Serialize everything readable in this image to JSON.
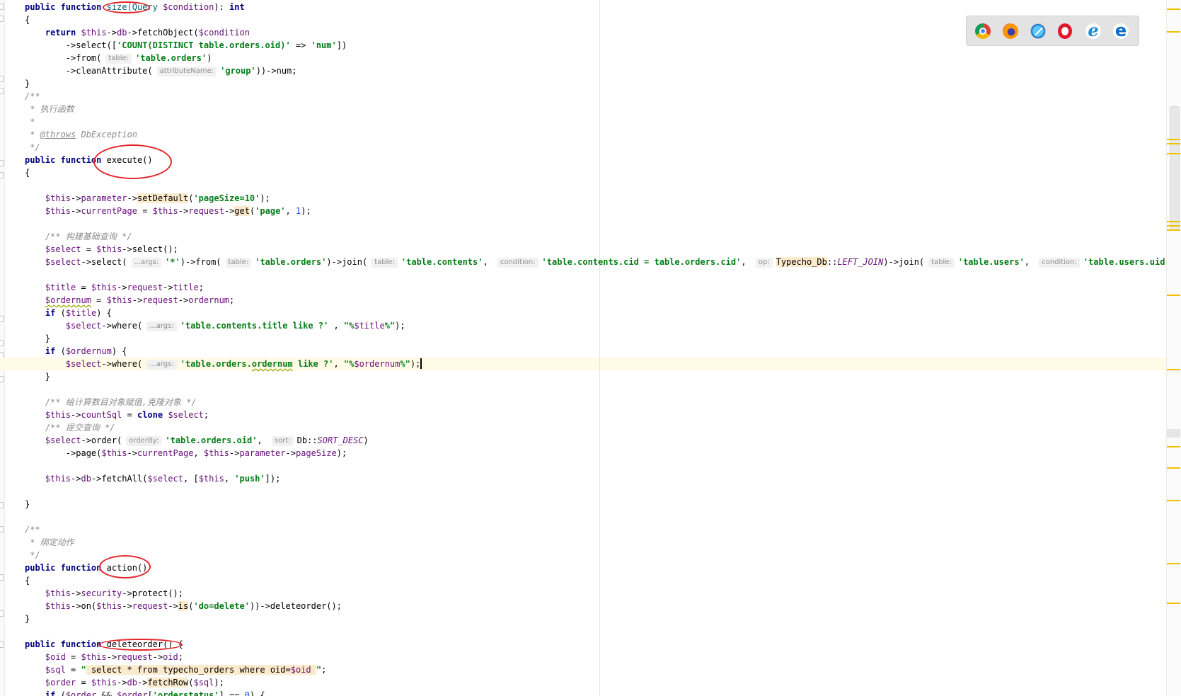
{
  "editor": {
    "lines": [
      {
        "parts": [
          {
            "t": "public function ",
            "c": "kw"
          },
          {
            "t": "size(Query ",
            "c": "fn"
          },
          {
            "t": "$condition",
            "c": "var"
          },
          {
            "t": "): "
          },
          {
            "t": "int",
            "c": "kw"
          }
        ]
      },
      {
        "parts": [
          {
            "t": "{"
          }
        ]
      },
      {
        "parts": [
          {
            "t": "    "
          },
          {
            "t": "return ",
            "c": "kw"
          },
          {
            "t": "$this",
            "c": "var"
          },
          {
            "t": "->"
          },
          {
            "t": "db",
            "c": "var"
          },
          {
            "t": "->fetchObject("
          },
          {
            "t": "$condition",
            "c": "var"
          }
        ]
      },
      {
        "parts": [
          {
            "t": "        ->select(["
          },
          {
            "t": "'COUNT(DISTINCT table.orders.oid)'",
            "c": "s"
          },
          {
            "t": " => "
          },
          {
            "t": "'num'",
            "c": "s"
          },
          {
            "t": "])"
          }
        ]
      },
      {
        "parts": [
          {
            "t": "        ->from("
          },
          {
            "h": "table:"
          },
          {
            "t": "'table.orders'",
            "c": "s"
          },
          {
            "t": ")"
          }
        ]
      },
      {
        "parts": [
          {
            "t": "        ->cleanAttribute("
          },
          {
            "h": "attributeName:"
          },
          {
            "t": "'group'",
            "c": "s"
          },
          {
            "t": "))->num;"
          }
        ]
      },
      {
        "parts": [
          {
            "t": "}"
          }
        ]
      },
      {
        "parts": [
          {
            "t": "/**",
            "c": "cm"
          }
        ]
      },
      {
        "parts": [
          {
            "t": " * 执行函数",
            "c": "cm"
          }
        ]
      },
      {
        "parts": [
          {
            "t": " *",
            "c": "cm"
          }
        ]
      },
      {
        "parts": [
          {
            "t": " * ",
            "c": "cm"
          },
          {
            "t": "@throws",
            "c": "tag"
          },
          {
            "t": " DbException",
            "c": "cm"
          }
        ]
      },
      {
        "parts": [
          {
            "t": " */",
            "c": "cm"
          }
        ]
      },
      {
        "parts": [
          {
            "t": "public function ",
            "c": "kw"
          },
          {
            "t": "execute()"
          }
        ]
      },
      {
        "parts": [
          {
            "t": "{"
          }
        ]
      },
      {
        "parts": []
      },
      {
        "parts": [
          {
            "t": "    "
          },
          {
            "t": "$this",
            "c": "var"
          },
          {
            "t": "->"
          },
          {
            "t": "parameter",
            "c": "var"
          },
          {
            "t": "->"
          },
          {
            "t": "setDefault",
            "c": "hl"
          },
          {
            "t": "("
          },
          {
            "t": "'pageSize=10'",
            "c": "s"
          },
          {
            "t": ");"
          }
        ]
      },
      {
        "parts": [
          {
            "t": "    "
          },
          {
            "t": "$this",
            "c": "var"
          },
          {
            "t": "->"
          },
          {
            "t": "currentPage",
            "c": "var"
          },
          {
            "t": " = "
          },
          {
            "t": "$this",
            "c": "var"
          },
          {
            "t": "->"
          },
          {
            "t": "request",
            "c": "var"
          },
          {
            "t": "->"
          },
          {
            "t": "get",
            "c": "hl"
          },
          {
            "t": "("
          },
          {
            "t": "'page'",
            "c": "s"
          },
          {
            "t": ", "
          },
          {
            "t": "1",
            "c": "num"
          },
          {
            "t": ");"
          }
        ]
      },
      {
        "parts": []
      },
      {
        "parts": [
          {
            "t": "    "
          },
          {
            "t": "/** 构建基础查询 */",
            "c": "cm"
          }
        ]
      },
      {
        "parts": [
          {
            "t": "    "
          },
          {
            "t": "$select",
            "c": "var"
          },
          {
            "t": " = "
          },
          {
            "t": "$this",
            "c": "var"
          },
          {
            "t": "->select();"
          }
        ]
      },
      {
        "parts": [
          {
            "t": "    "
          },
          {
            "t": "$select",
            "c": "var"
          },
          {
            "t": "->select("
          },
          {
            "h": "...args:"
          },
          {
            "t": "'*'",
            "c": "s"
          },
          {
            "t": ")->from("
          },
          {
            "h": "table:"
          },
          {
            "t": "'table.orders'",
            "c": "s"
          },
          {
            "t": ")->join("
          },
          {
            "h": "table:"
          },
          {
            "t": "'table.contents'",
            "c": "s"
          },
          {
            "t": ", "
          },
          {
            "h": "condition:"
          },
          {
            "t": "'table.contents.cid = table.orders.cid'",
            "c": "s"
          },
          {
            "t": ", "
          },
          {
            "h": "op:"
          },
          {
            "t": "Typecho_Db",
            "c": "hl"
          },
          {
            "t": "::"
          },
          {
            "t": "LEFT_JOIN",
            "c": "const"
          },
          {
            "t": ")->join("
          },
          {
            "h": "table:"
          },
          {
            "t": "'table.users'",
            "c": "s"
          },
          {
            "t": ", "
          },
          {
            "h": "condition:"
          },
          {
            "t": "'table.users.uid = table.",
            "c": "s"
          }
        ]
      },
      {
        "parts": []
      },
      {
        "parts": [
          {
            "t": "    "
          },
          {
            "t": "$title",
            "c": "var"
          },
          {
            "t": " = "
          },
          {
            "t": "$this",
            "c": "var"
          },
          {
            "t": "->"
          },
          {
            "t": "request",
            "c": "var"
          },
          {
            "t": "->"
          },
          {
            "t": "title",
            "c": "var"
          },
          {
            "t": ";"
          }
        ]
      },
      {
        "parts": [
          {
            "t": "    "
          },
          {
            "t": "$ordernum",
            "c": "var warn"
          },
          {
            "t": " = "
          },
          {
            "t": "$this",
            "c": "var"
          },
          {
            "t": "->"
          },
          {
            "t": "request",
            "c": "var"
          },
          {
            "t": "->"
          },
          {
            "t": "ordernum",
            "c": "var"
          },
          {
            "t": ";"
          }
        ]
      },
      {
        "parts": [
          {
            "t": "    "
          },
          {
            "t": "if ",
            "c": "kw"
          },
          {
            "t": "("
          },
          {
            "t": "$title",
            "c": "var"
          },
          {
            "t": ") {"
          }
        ]
      },
      {
        "parts": [
          {
            "t": "        "
          },
          {
            "t": "$select",
            "c": "var"
          },
          {
            "t": "->where("
          },
          {
            "h": "...args:"
          },
          {
            "t": "'table.contents.title like ?'",
            "c": "s"
          },
          {
            "t": " , "
          },
          {
            "t": "\"%",
            "c": "s"
          },
          {
            "t": "$title",
            "c": "var"
          },
          {
            "t": "%\"",
            "c": "s"
          },
          {
            "t": ");"
          }
        ]
      },
      {
        "parts": [
          {
            "t": "    }"
          }
        ]
      },
      {
        "parts": [
          {
            "t": "    "
          },
          {
            "t": "if ",
            "c": "kw"
          },
          {
            "t": "("
          },
          {
            "t": "$ordernum",
            "c": "var"
          },
          {
            "t": ") {"
          }
        ]
      },
      {
        "parts": [
          {
            "t": "        "
          },
          {
            "t": "$select",
            "c": "var"
          },
          {
            "t": "->where("
          },
          {
            "h": "...args:"
          },
          {
            "t": "'table.orders.",
            "c": "s"
          },
          {
            "t": "ordernum",
            "c": "s warn"
          },
          {
            "t": " like ?'",
            "c": "s"
          },
          {
            "t": ", "
          },
          {
            "t": "\"%",
            "c": "s"
          },
          {
            "t": "$ordernum",
            "c": "var"
          },
          {
            "t": "%\"",
            "c": "s"
          },
          {
            "t": ");"
          },
          {
            "caret": true
          }
        ]
      },
      {
        "parts": [
          {
            "t": "    }"
          }
        ]
      },
      {
        "parts": []
      },
      {
        "parts": [
          {
            "t": "    "
          },
          {
            "t": "/** 给计算数目对象赋值,克隆对象 */",
            "c": "cm"
          }
        ]
      },
      {
        "parts": [
          {
            "t": "    "
          },
          {
            "t": "$this",
            "c": "var"
          },
          {
            "t": "->"
          },
          {
            "t": "countSql",
            "c": "var"
          },
          {
            "t": " = "
          },
          {
            "t": "clone ",
            "c": "kw"
          },
          {
            "t": "$select",
            "c": "var"
          },
          {
            "t": ";"
          }
        ]
      },
      {
        "parts": [
          {
            "t": "    "
          },
          {
            "t": "/** 提交查询 */",
            "c": "cm"
          }
        ]
      },
      {
        "parts": [
          {
            "t": "    "
          },
          {
            "t": "$select",
            "c": "var"
          },
          {
            "t": "->order("
          },
          {
            "h": "orderBy:"
          },
          {
            "t": "'table.orders.oid'",
            "c": "s"
          },
          {
            "t": ", "
          },
          {
            "h": "sort:"
          },
          {
            "t": "Db::"
          },
          {
            "t": "SORT_DESC",
            "c": "const"
          },
          {
            "t": ")"
          }
        ]
      },
      {
        "parts": [
          {
            "t": "        ->page("
          },
          {
            "t": "$this",
            "c": "var"
          },
          {
            "t": "->"
          },
          {
            "t": "currentPage",
            "c": "var"
          },
          {
            "t": ", "
          },
          {
            "t": "$this",
            "c": "var"
          },
          {
            "t": "->"
          },
          {
            "t": "parameter",
            "c": "var"
          },
          {
            "t": "->"
          },
          {
            "t": "pageSize",
            "c": "var"
          },
          {
            "t": ");"
          }
        ]
      },
      {
        "parts": []
      },
      {
        "parts": [
          {
            "t": "    "
          },
          {
            "t": "$this",
            "c": "var"
          },
          {
            "t": "->"
          },
          {
            "t": "db",
            "c": "var"
          },
          {
            "t": "->fetchAll("
          },
          {
            "t": "$select",
            "c": "var"
          },
          {
            "t": ", ["
          },
          {
            "t": "$this",
            "c": "var"
          },
          {
            "t": ", "
          },
          {
            "t": "'push'",
            "c": "s"
          },
          {
            "t": "]);"
          }
        ]
      },
      {
        "parts": []
      },
      {
        "parts": [
          {
            "t": "}"
          }
        ]
      },
      {
        "parts": []
      },
      {
        "parts": [
          {
            "t": "/**",
            "c": "cm"
          }
        ]
      },
      {
        "parts": [
          {
            "t": " * 绑定动作",
            "c": "cm"
          }
        ]
      },
      {
        "parts": [
          {
            "t": " */",
            "c": "cm"
          }
        ]
      },
      {
        "parts": [
          {
            "t": "public function ",
            "c": "kw"
          },
          {
            "t": "action()"
          }
        ]
      },
      {
        "parts": [
          {
            "t": "{"
          }
        ]
      },
      {
        "parts": [
          {
            "t": "    "
          },
          {
            "t": "$this",
            "c": "var"
          },
          {
            "t": "->"
          },
          {
            "t": "security",
            "c": "var"
          },
          {
            "t": "->protect();"
          }
        ]
      },
      {
        "parts": [
          {
            "t": "    "
          },
          {
            "t": "$this",
            "c": "var"
          },
          {
            "t": "->on("
          },
          {
            "t": "$this",
            "c": "var"
          },
          {
            "t": "->"
          },
          {
            "t": "request",
            "c": "var"
          },
          {
            "t": "->"
          },
          {
            "t": "is",
            "c": "hl"
          },
          {
            "t": "("
          },
          {
            "t": "'do=delete'",
            "c": "s"
          },
          {
            "t": "))->deleteorder();"
          }
        ]
      },
      {
        "parts": [
          {
            "t": "}"
          }
        ]
      },
      {
        "parts": []
      },
      {
        "parts": [
          {
            "t": "public function ",
            "c": "kw"
          },
          {
            "t": "deleteorder() {"
          }
        ]
      },
      {
        "parts": [
          {
            "t": "    "
          },
          {
            "t": "$oid",
            "c": "var"
          },
          {
            "t": " = "
          },
          {
            "t": "$this",
            "c": "var"
          },
          {
            "t": "->"
          },
          {
            "t": "request",
            "c": "var"
          },
          {
            "t": "->"
          },
          {
            "t": "oid",
            "c": "var"
          },
          {
            "t": ";"
          }
        ]
      },
      {
        "parts": [
          {
            "t": "    "
          },
          {
            "t": "$sql",
            "c": "var"
          },
          {
            "t": " = "
          },
          {
            "t": "\"",
            "c": "s"
          },
          {
            "t": " select * from typecho_orders where oid=",
            "c": "hl"
          },
          {
            "t": "$oid",
            "c": "var hl"
          },
          {
            "t": " ",
            "c": "hl"
          },
          {
            "t": "\"",
            "c": "s"
          },
          {
            "t": ";"
          }
        ]
      },
      {
        "parts": [
          {
            "t": "    "
          },
          {
            "t": "$order",
            "c": "var"
          },
          {
            "t": " = "
          },
          {
            "t": "$this",
            "c": "var"
          },
          {
            "t": "->"
          },
          {
            "t": "db",
            "c": "var"
          },
          {
            "t": "->"
          },
          {
            "t": "fetchRow",
            "c": "hl"
          },
          {
            "t": "("
          },
          {
            "t": "$sql",
            "c": "var"
          },
          {
            "t": ");"
          }
        ]
      },
      {
        "parts": [
          {
            "t": "    "
          },
          {
            "t": "if ",
            "c": "kw"
          },
          {
            "t": "("
          },
          {
            "t": "$order",
            "c": "var"
          },
          {
            "t": " && "
          },
          {
            "t": "$order",
            "c": "var"
          },
          {
            "t": "["
          },
          {
            "t": "'orderstatus'",
            "c": "s"
          },
          {
            "t": "] == "
          },
          {
            "t": "0",
            "c": "num"
          },
          {
            "t": ") {"
          }
        ]
      }
    ]
  },
  "browser_icons": [
    {
      "name": "chrome-icon",
      "kind": "chrome"
    },
    {
      "name": "firefox-icon",
      "kind": "firefox"
    },
    {
      "name": "safari-icon",
      "kind": "safari"
    },
    {
      "name": "opera-icon",
      "kind": "opera"
    },
    {
      "name": "ie-icon",
      "kind": "ie",
      "glyph": "e"
    },
    {
      "name": "edge-icon",
      "kind": "edge",
      "glyph": "e"
    }
  ]
}
